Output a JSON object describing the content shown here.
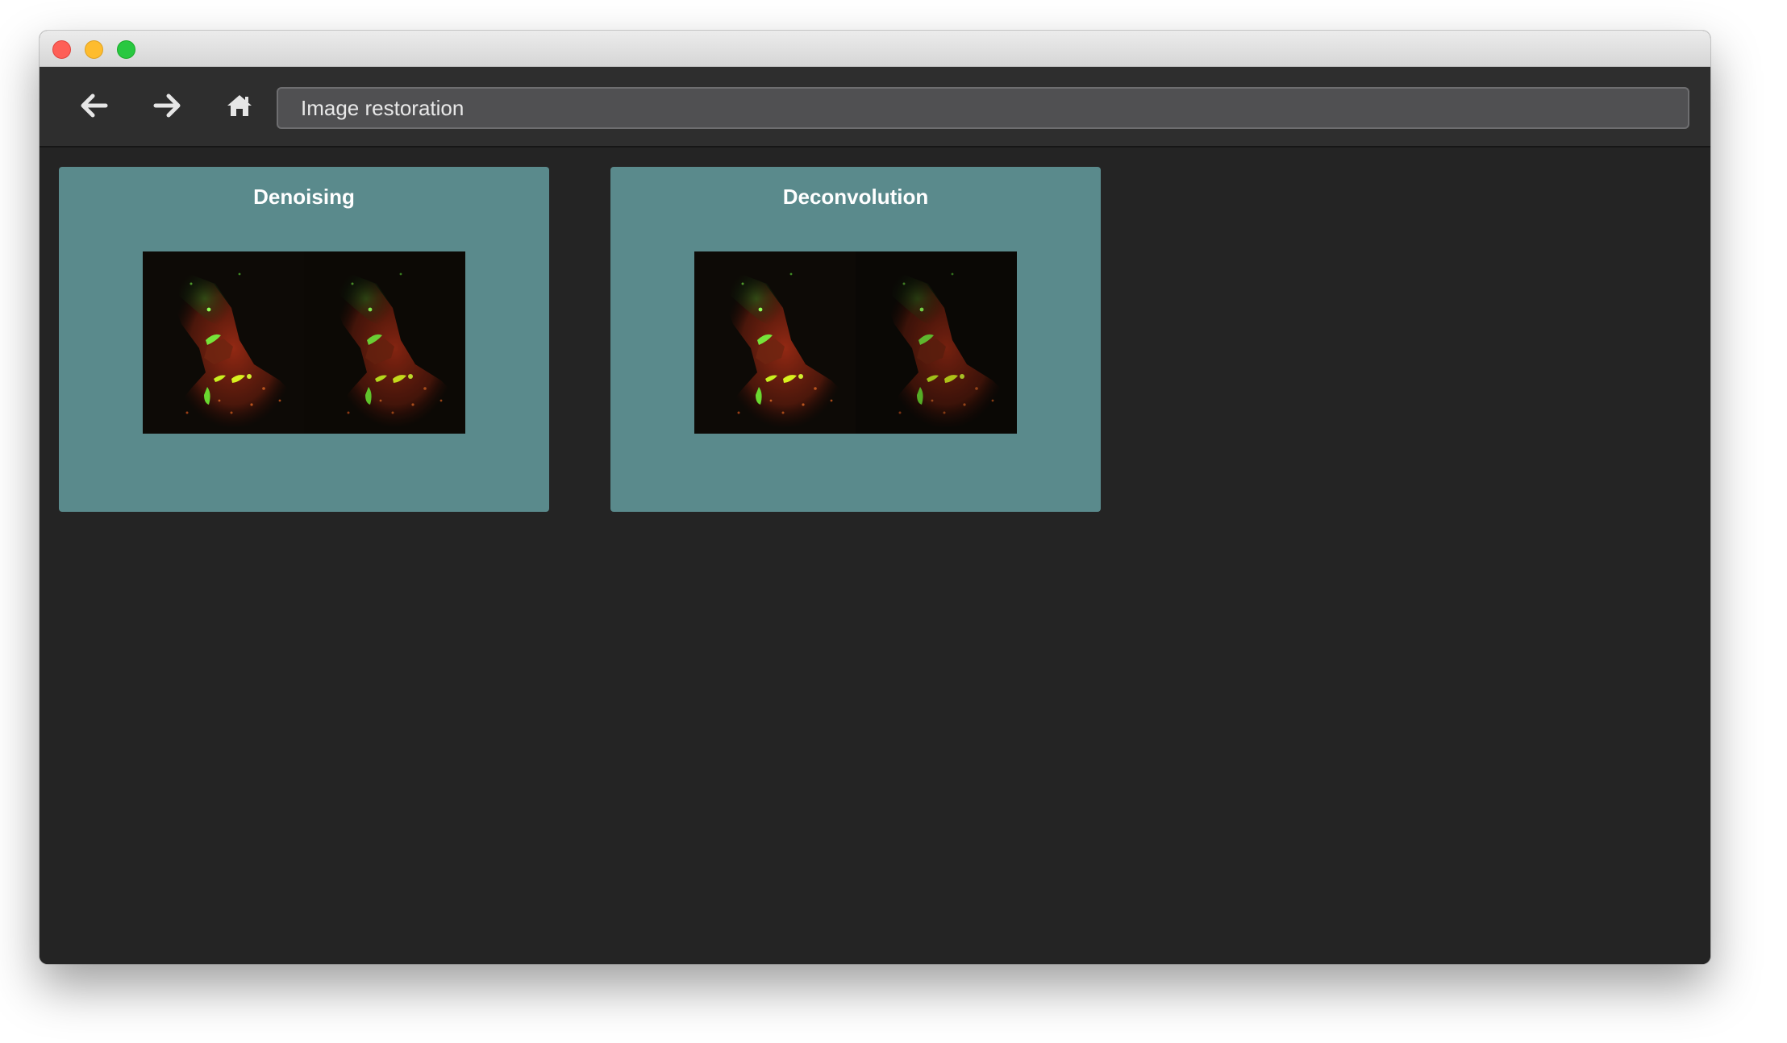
{
  "window": {
    "traffic_lights": [
      "close",
      "minimize",
      "zoom"
    ]
  },
  "toolbar": {
    "back_icon": "arrow-left-icon",
    "forward_icon": "arrow-right-icon",
    "home_icon": "home-icon",
    "address_value": "Image restoration"
  },
  "cards": [
    {
      "title": "Denoising",
      "image": "microscopy-cell-comparison"
    },
    {
      "title": "Deconvolution",
      "image": "microscopy-cell-comparison"
    }
  ],
  "colors": {
    "card_background": "#5a8a8c",
    "window_background": "#242424",
    "toolbar_background": "#2e2e2e",
    "address_background": "#505052"
  }
}
